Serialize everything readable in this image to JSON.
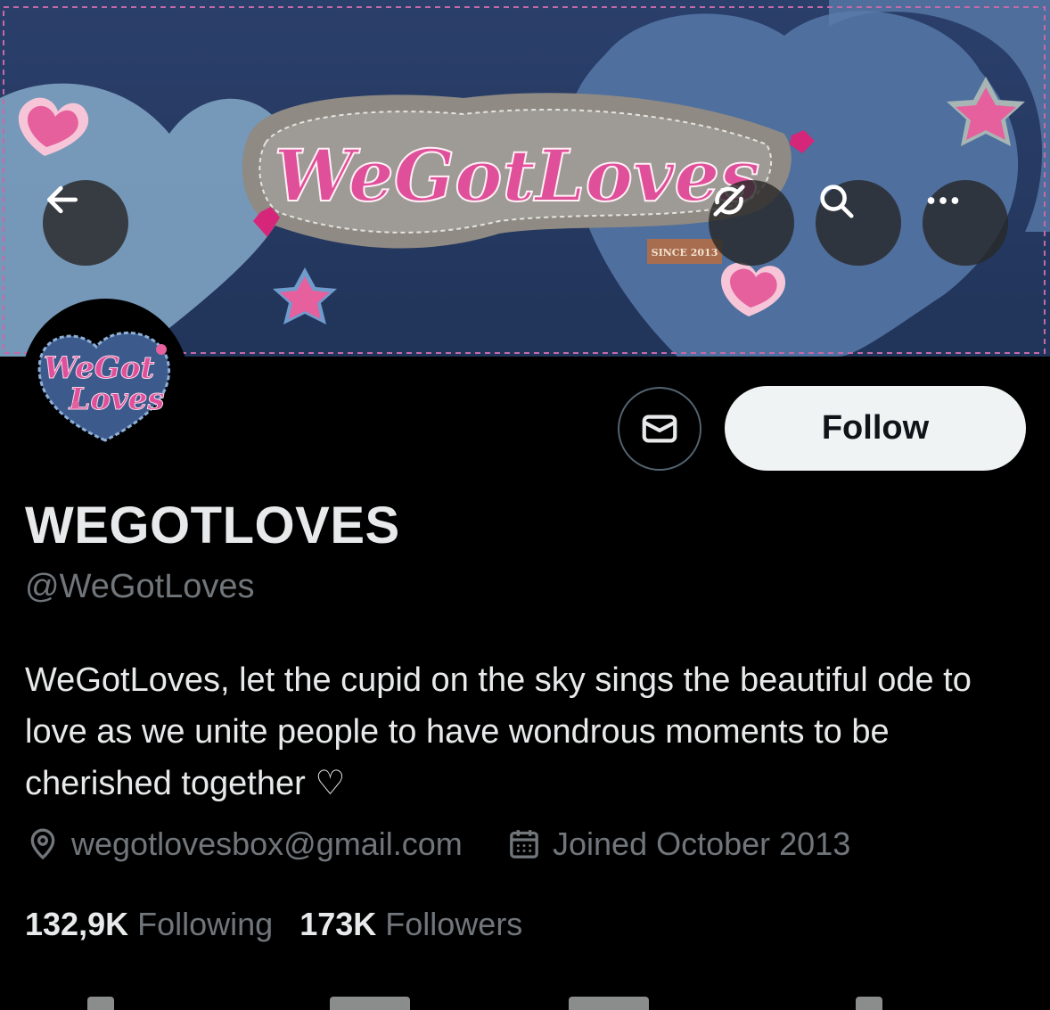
{
  "banner": {
    "logo_text": "WeGotLoves",
    "since_tag": "SINCE 2013"
  },
  "top_bar": {
    "back_icon": "arrow-left-icon",
    "refresh_icon": "refresh-icon",
    "search_icon": "search-icon",
    "more_icon": "more-horizontal-icon"
  },
  "avatar": {
    "logo_text_line1": "WeGot",
    "logo_text_line2": "Loves"
  },
  "actions": {
    "message_icon": "envelope-icon",
    "follow_label": "Follow"
  },
  "profile": {
    "display_name": "WEGOTLOVES",
    "handle": "@WeGotLoves",
    "bio": "WeGotLoves, let the cupid on the sky sings the beautiful ode to love as we unite people to have wondrous moments to be cherished together ♡",
    "location_icon": "location-pin-icon",
    "location": "wegotlovesbox@gmail.com",
    "joined_icon": "calendar-icon",
    "joined": "Joined October 2013"
  },
  "stats": {
    "following_count": "132,9K",
    "following_label": "Following",
    "followers_count": "173K",
    "followers_label": "Followers"
  },
  "colors": {
    "background": "#000000",
    "text_primary": "#e7e9ea",
    "text_secondary": "#71767b",
    "follow_bg": "#eff3f4",
    "denim_dark": "#263a63",
    "denim_light": "#7fa3c2",
    "pink": "#e04f98"
  }
}
